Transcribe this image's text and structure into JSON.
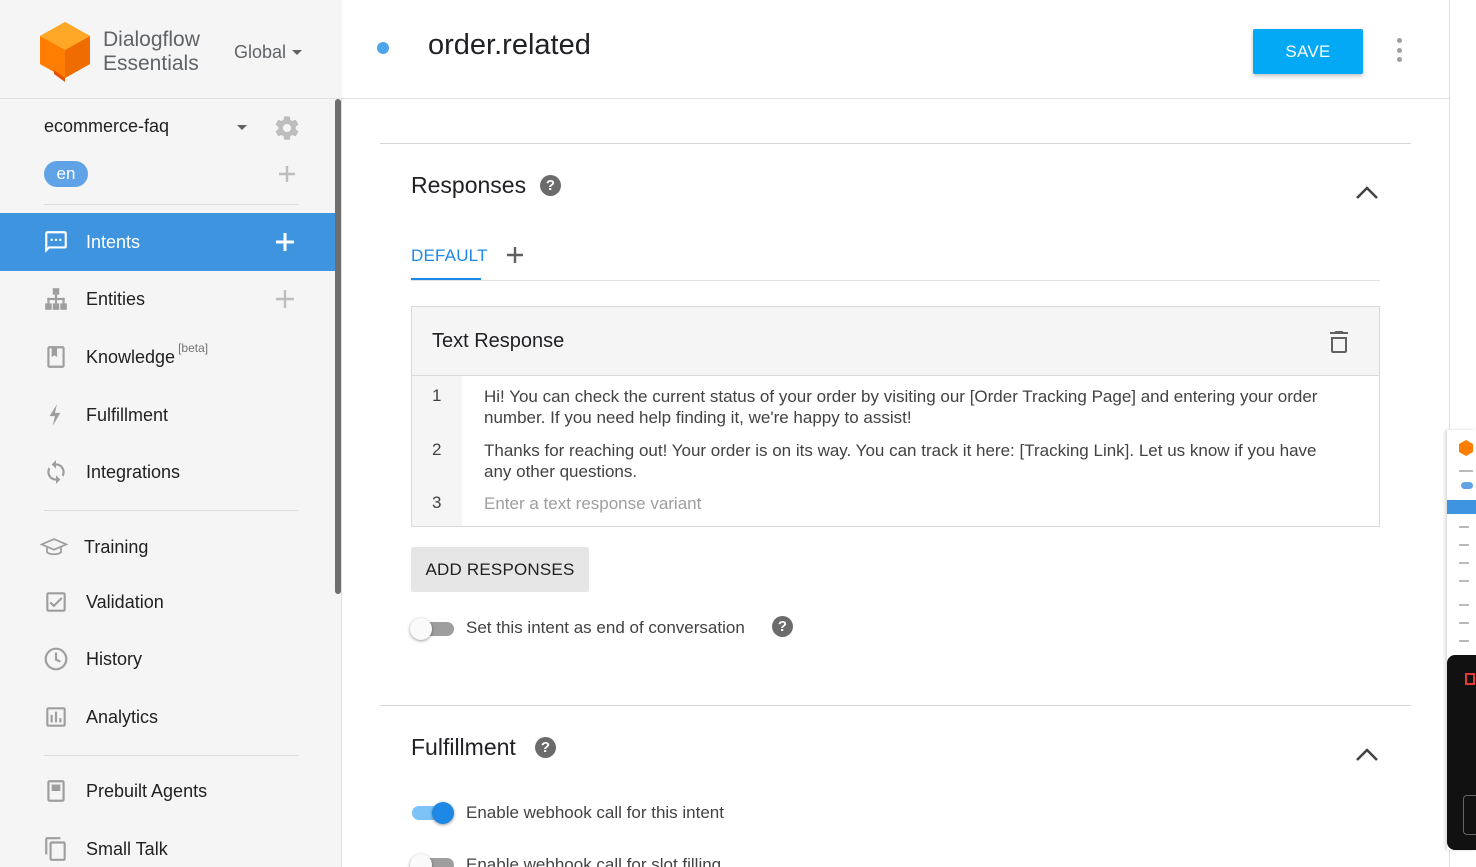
{
  "brand": {
    "name_line1": "Dialogflow",
    "name_line2": "Essentials",
    "region": "Global"
  },
  "agent": {
    "name": "ecommerce-faq",
    "language": "en"
  },
  "sidebar": {
    "items": [
      {
        "label": "Intents",
        "icon": "chat-bubble-icon",
        "active": true,
        "has_add": true
      },
      {
        "label": "Entities",
        "icon": "hierarchy-icon",
        "has_add": true
      },
      {
        "label": "Knowledge",
        "badge": "[beta]",
        "icon": "book-icon"
      },
      {
        "label": "Fulfillment",
        "icon": "lightning-icon"
      },
      {
        "label": "Integrations",
        "icon": "sync-icon"
      },
      {
        "label": "Training",
        "icon": "graduation-cap-icon"
      },
      {
        "label": "Validation",
        "icon": "checkbox-icon"
      },
      {
        "label": "History",
        "icon": "clock-icon"
      },
      {
        "label": "Analytics",
        "icon": "bar-chart-icon"
      },
      {
        "label": "Prebuilt Agents",
        "icon": "bookmark-book-icon"
      },
      {
        "label": "Small Talk",
        "icon": "copy-icon"
      }
    ]
  },
  "header": {
    "intent_name": "order.related",
    "save_label": "SAVE"
  },
  "responses": {
    "title": "Responses",
    "tab_label": "DEFAULT",
    "card_title": "Text Response",
    "rows": [
      {
        "num": "1",
        "text": "Hi! You can check the current status of your order by visiting our [Order Tracking Page] and entering your order number. If you need help finding it, we're happy to assist!"
      },
      {
        "num": "2",
        "text": "Thanks for reaching out! Your order is on its way. You can track it here: [Tracking Link]. Let us know if you have any other questions."
      }
    ],
    "new_row_num": "3",
    "new_row_placeholder": "Enter a text response variant",
    "add_button": "ADD RESPONSES",
    "end_conversation_label": "Set this intent as end of conversation",
    "end_conversation_on": false
  },
  "fulfillment": {
    "title": "Fulfillment",
    "webhook_label": "Enable webhook call for this intent",
    "webhook_on": true,
    "slot_label": "Enable webhook call for slot filling",
    "slot_on": false
  },
  "colors": {
    "accent": "#3f94e0",
    "save": "#03a9f4",
    "logo": "#ff6d00"
  }
}
